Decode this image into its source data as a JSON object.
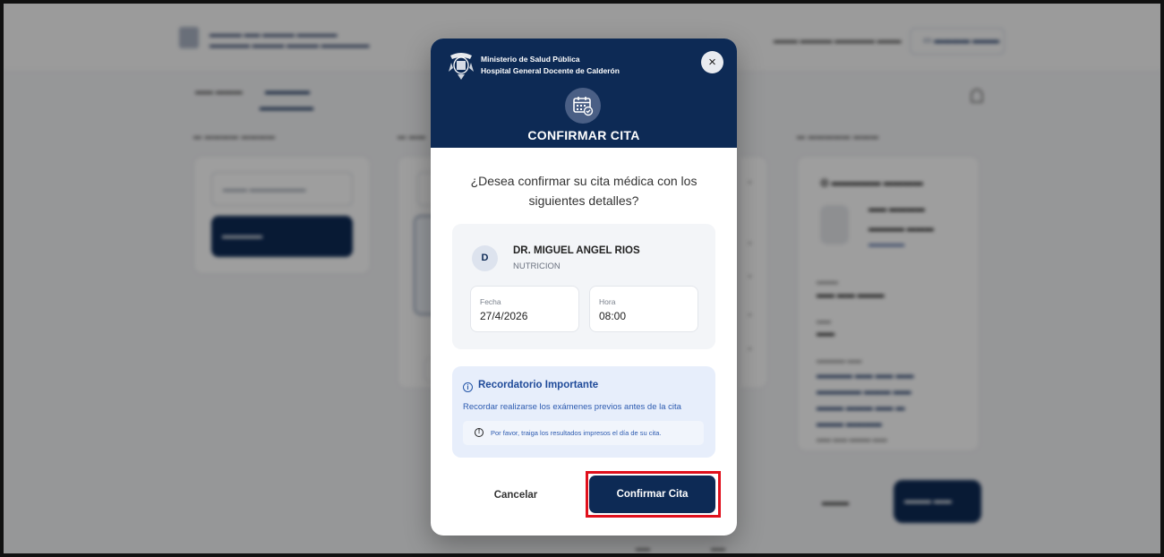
{
  "modal": {
    "org_line1": "Ministerio de Salud Pública",
    "org_line2": "Hospital General Docente de Calderón",
    "close_label": "×",
    "title": "CONFIRMAR CITA",
    "question": "¿Desea confirmar su cita médica con los siguientes detalles?",
    "doctor": {
      "initial": "D",
      "name": "DR. MIGUEL ANGEL RIOS",
      "specialty": "NUTRICION"
    },
    "fecha_label": "Fecha",
    "fecha_value": "27/4/2026",
    "hora_label": "Hora",
    "hora_value": "08:00",
    "reminder": {
      "title": "Recordatorio Importante",
      "text": "Recordar realizarse los exámenes previos antes de la cita",
      "note": "Por favor, traiga los resultados impresos el día de su cita."
    },
    "cancel_label": "Cancelar",
    "confirm_label": "Confirmar Cita"
  },
  "colors": {
    "header_bg": "#0d2a55",
    "accent_blue": "#1f4a99",
    "highlight_red": "#e0101c"
  },
  "icons": [
    "seal-icon",
    "close-icon",
    "calendar-check-icon",
    "info-icon"
  ]
}
